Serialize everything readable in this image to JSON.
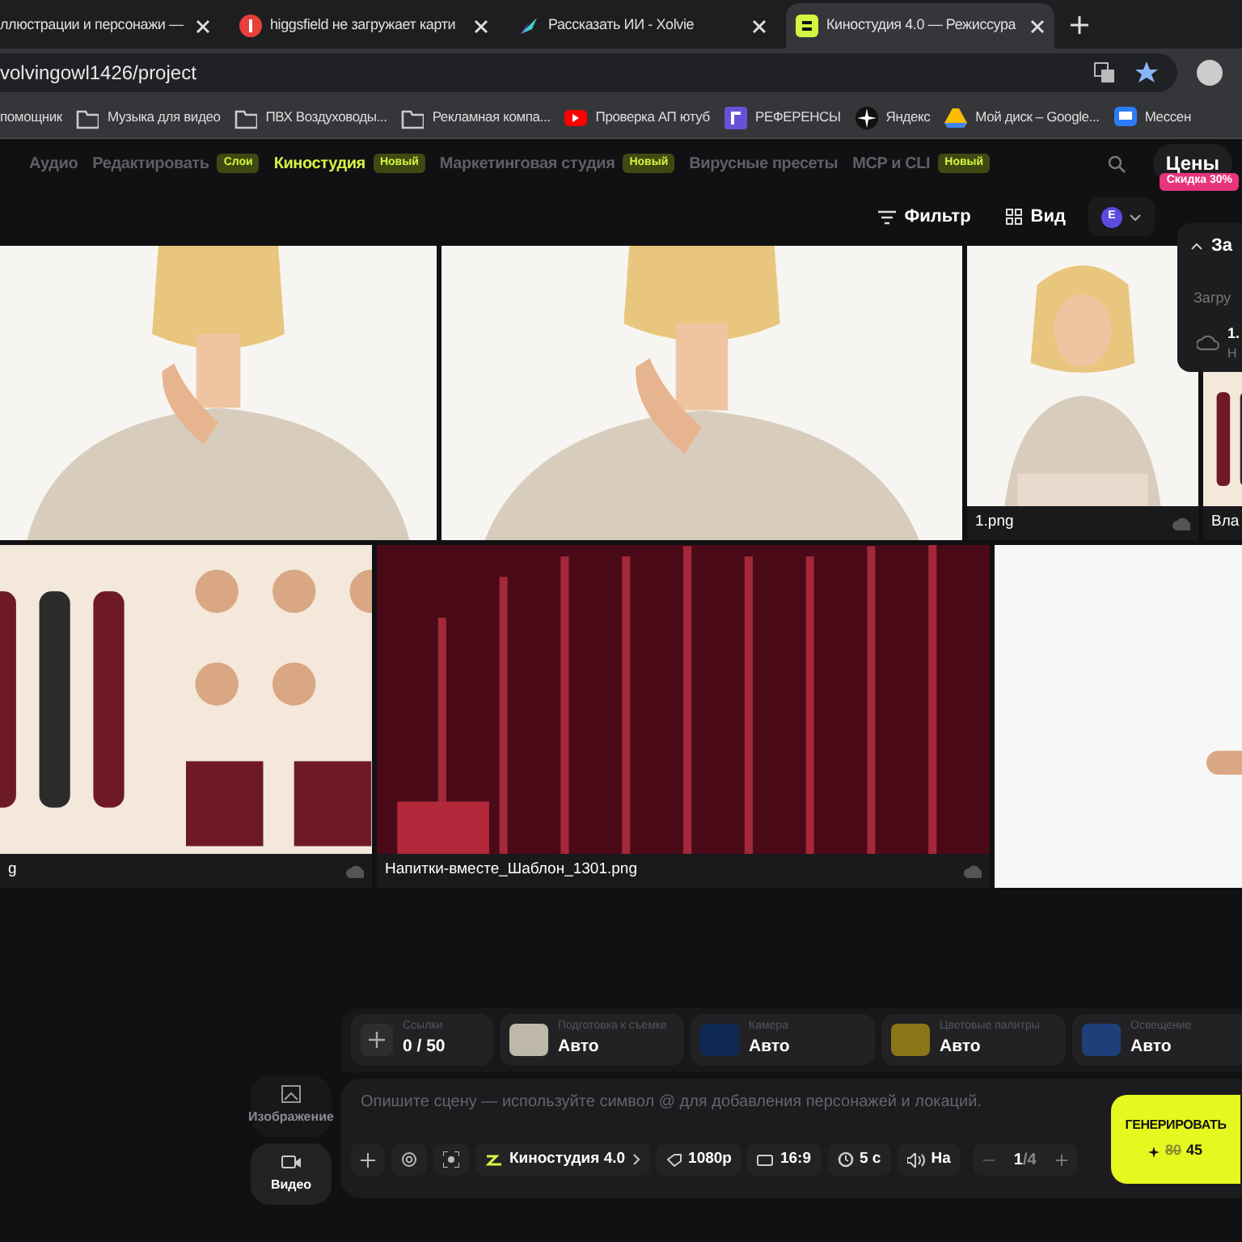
{
  "browser_tabs": [
    {
      "title": "ллюстрации и персонажи —",
      "selected": false
    },
    {
      "title": "higgsfield не загружает карти",
      "selected": false
    },
    {
      "title": "Рассказать ИИ - Xolvie",
      "selected": false
    },
    {
      "title": "Киностудия 4.0 — Режиссура",
      "selected": true
    }
  ],
  "address": "volvingowl1426/project",
  "bookmarks": [
    {
      "label": "помощник",
      "kind": "none"
    },
    {
      "label": "Музыка для видео",
      "kind": "folder"
    },
    {
      "label": "ПВХ Воздуховоды...",
      "kind": "folder"
    },
    {
      "label": "Рекламная компа...",
      "kind": "folder"
    },
    {
      "label": "Проверка АП ютуб",
      "kind": "video"
    },
    {
      "label": "РЕФЕРЕНСЫ",
      "kind": "square"
    },
    {
      "label": "Яндекс",
      "kind": "star"
    },
    {
      "label": "Мой диск – Google...",
      "kind": "drive"
    },
    {
      "label": "Мессен",
      "kind": "chat"
    }
  ],
  "nav": [
    {
      "label": "Аудио",
      "selected": false
    },
    {
      "label": "Редактировать",
      "badge": "Слои",
      "selected": false
    },
    {
      "label": "Киностудия",
      "badge": "Новый",
      "selected": true
    },
    {
      "label": "Маркетинговая студия",
      "badge": "Новый",
      "selected": false
    },
    {
      "label": "Вирусные пресеты",
      "selected": false
    },
    {
      "label": "MCP и CLI",
      "badge": "Новый",
      "selected": false
    }
  ],
  "pricing": {
    "label": "Цены",
    "discount": "Скидка 30%"
  },
  "toolbar": {
    "filter": "Фильтр",
    "view": "Вид",
    "avatar": "E"
  },
  "upload_panel": {
    "title": "За",
    "section": "Загру",
    "file": "1.",
    "status": "Н"
  },
  "gallery": [
    [
      {
        "kind": "picture"
      },
      {
        "kind": "picture"
      },
      {
        "kind": "picture",
        "label": "1.png"
      },
      {
        "kind": "picture",
        "label": "Вла"
      }
    ],
    [
      {
        "kind": "picture",
        "label": "g"
      },
      {
        "kind": "picture",
        "label": "Напитки-вместе_Шаблон_1301.png"
      },
      {
        "kind": "picture"
      }
    ]
  ],
  "modes": [
    {
      "label": "Изображение",
      "selected": false
    },
    {
      "label": "Видео",
      "selected": true
    }
  ],
  "settings": [
    {
      "label": "Ссылки",
      "value": "0 / 50"
    },
    {
      "label": "Подготовка к съемке",
      "value": "Авто"
    },
    {
      "label": "Камера",
      "value": "Авто"
    },
    {
      "label": "Цветовые палитры",
      "value": "Авто"
    },
    {
      "label": "Освещение",
      "value": "Авто"
    }
  ],
  "prompt": {
    "placeholder": "Опишите сцену — используйте символ @ для добавления персонажей и локаций."
  },
  "controls": {
    "model": "Киностудия 4.0",
    "resolution": "1080p",
    "aspect": "16:9",
    "duration": "5 с",
    "sound": "На",
    "count": "1",
    "count_total": "/4"
  },
  "generate": {
    "label": "ГЕНЕРИРОВАТЬ",
    "old_price": "80",
    "price": "45"
  }
}
